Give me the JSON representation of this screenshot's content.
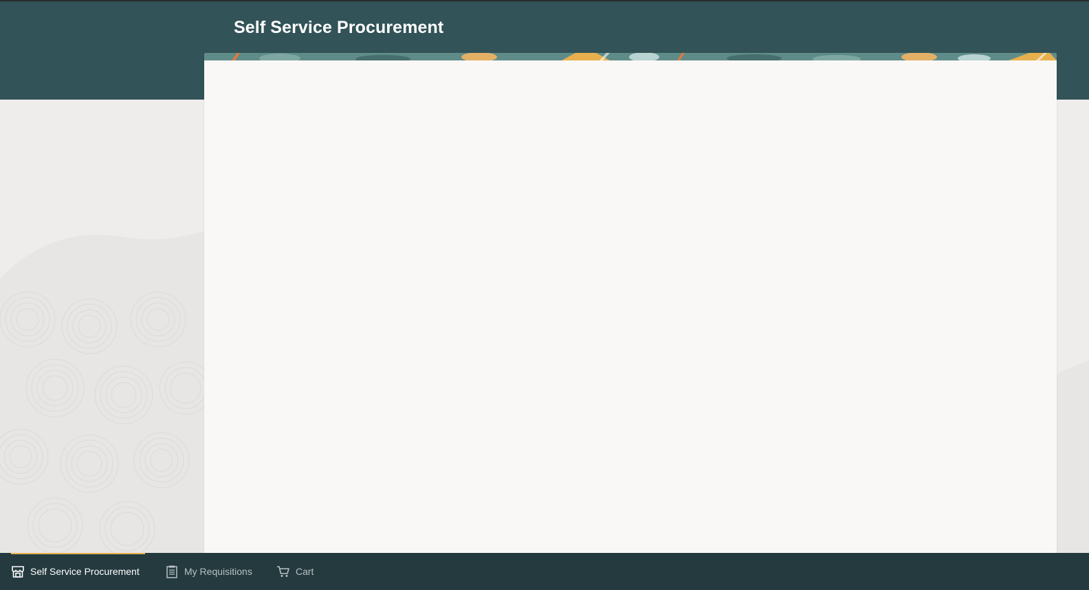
{
  "header": {
    "title": "Self Service Procurement"
  },
  "colors": {
    "header": "#325358",
    "bottom_bar": "#243a3f",
    "active_indicator": "#e8b04d",
    "card": "#faf8f6",
    "page_bg": "#efedeb"
  },
  "bottom_nav": {
    "items": [
      {
        "label": "Self Service Procurement",
        "icon": "store-icon",
        "active": true
      },
      {
        "label": "My Requisitions",
        "icon": "clipboard-icon",
        "active": false
      },
      {
        "label": "Cart",
        "icon": "cart-icon",
        "active": false
      }
    ]
  }
}
